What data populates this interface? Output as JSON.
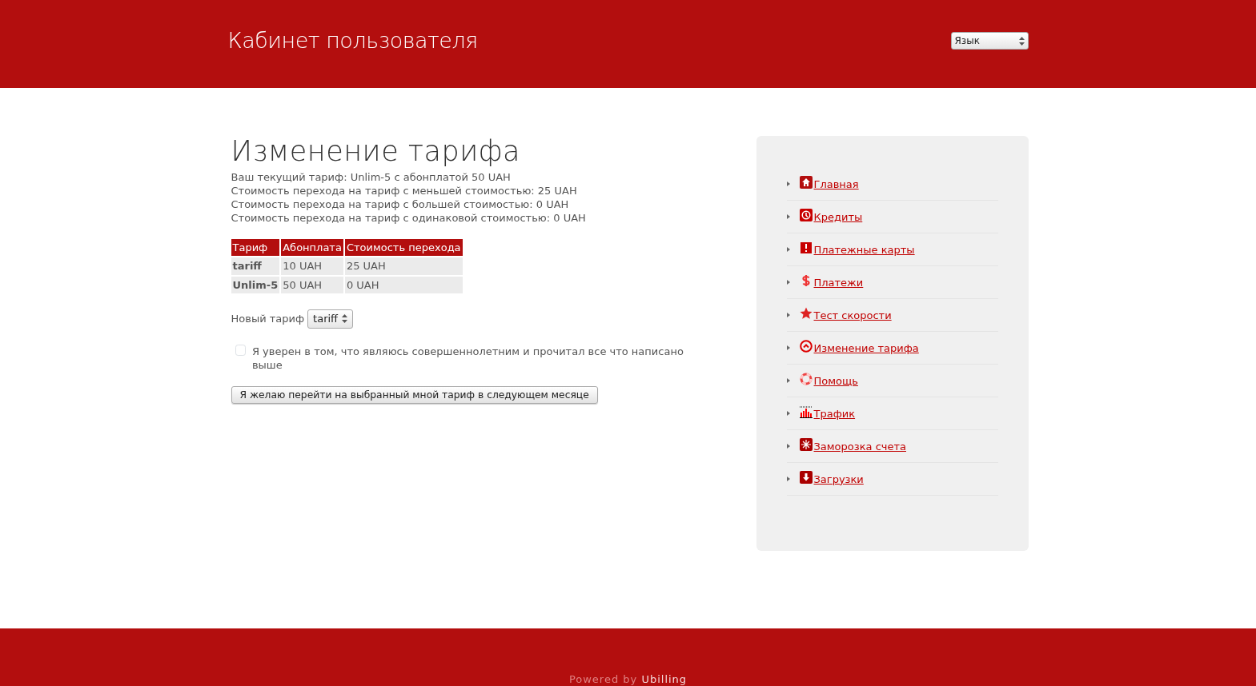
{
  "header": {
    "title": "Кабинет пользователя",
    "language_select": {
      "value": "Язык"
    }
  },
  "page": {
    "heading": "Изменение тарифа",
    "info_lines": [
      "Ваш текущий тариф: Unlim-5 с абонплатой 50 UAH",
      "Стоимость перехода на тариф с меньшей стоимостью: 25 UAH",
      "Стоимость перехода на тариф с большей стоимостью: 0 UAH",
      "Стоимость перехода на тариф с одинаковой стоимостью: 0 UAH"
    ],
    "table": {
      "columns": [
        "Тариф",
        "Абонплата",
        "Стоимость перехода"
      ],
      "rows": [
        [
          "tariff",
          "10 UAH",
          "25 UAH"
        ],
        [
          "Unlim-5",
          "50 UAH",
          "0 UAH"
        ]
      ]
    },
    "new_tariff": {
      "label": "Новый тариф",
      "value": "tariff"
    },
    "agreement": {
      "label": "Я уверен в том, что являюсь совершеннолетним и прочитал все что написано выше",
      "checked": false
    },
    "submit_button": "Я желаю перейти на выбранный мной тариф в следующем месяце"
  },
  "sidebar": {
    "items": [
      {
        "label": "Главная"
      },
      {
        "label": "Кредиты"
      },
      {
        "label": "Платежные карты"
      },
      {
        "label": "Платежи"
      },
      {
        "label": "Тест скорости"
      },
      {
        "label": "Изменение тарифа"
      },
      {
        "label": "Помощь"
      },
      {
        "label": "Трафик"
      },
      {
        "label": "Заморозка счета"
      },
      {
        "label": "Загрузки"
      }
    ]
  },
  "footer": {
    "prefix": "Powered by",
    "link": "Ubilling"
  }
}
